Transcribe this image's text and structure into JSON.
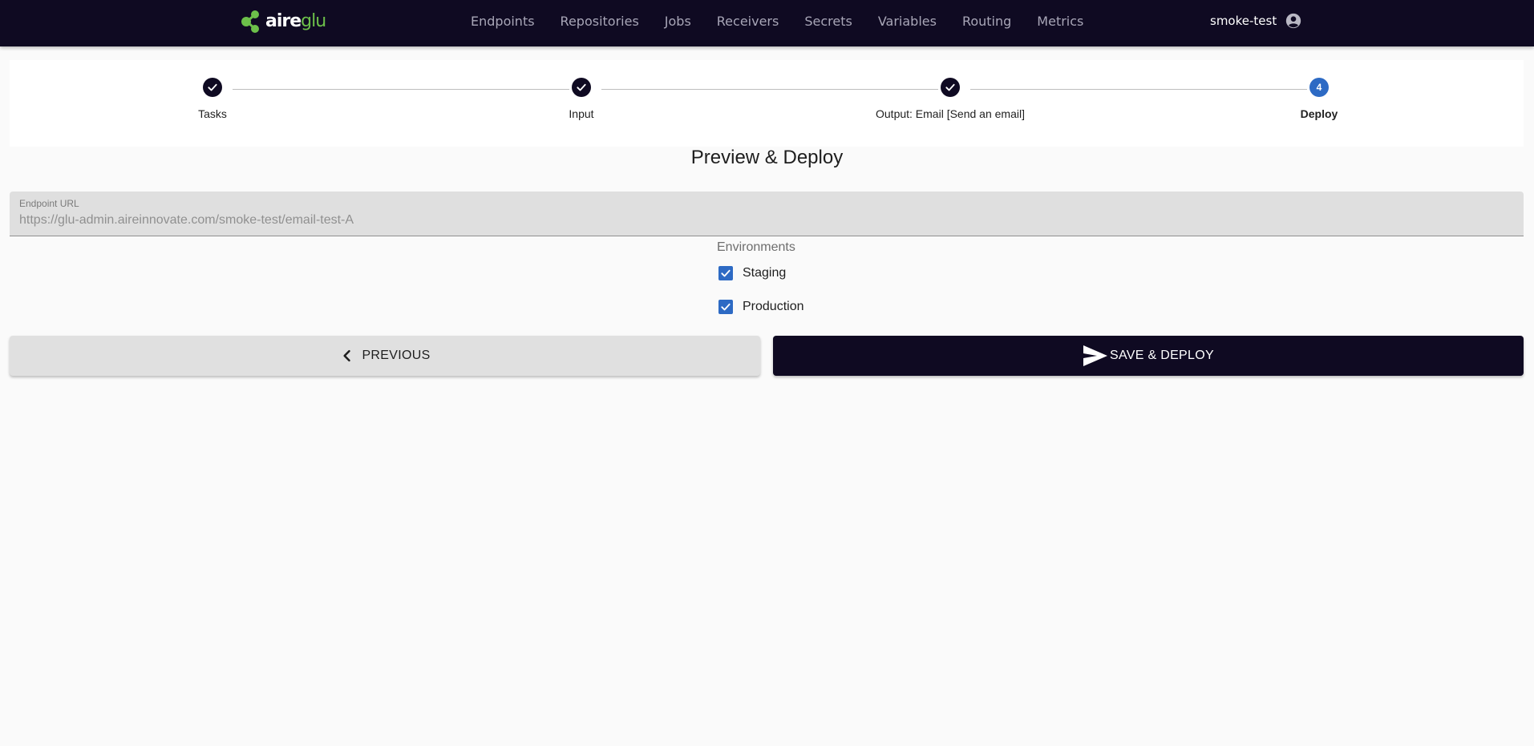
{
  "brand": {
    "part1": "aire",
    "part2": "glu",
    "accent_color": "#6cc04a"
  },
  "nav": {
    "items": [
      "Endpoints",
      "Repositories",
      "Jobs",
      "Receivers",
      "Secrets",
      "Variables",
      "Routing",
      "Metrics"
    ]
  },
  "user": {
    "name": "smoke-test",
    "icon": "account-circle-icon"
  },
  "stepper": {
    "steps": [
      {
        "label": "Tasks",
        "state": "completed"
      },
      {
        "label": "Input",
        "state": "completed"
      },
      {
        "label": "Output: Email [Send an email]",
        "state": "completed"
      },
      {
        "label": "Deploy",
        "state": "active",
        "number": "4"
      }
    ]
  },
  "page": {
    "title": "Preview & Deploy"
  },
  "endpoint": {
    "label": "Endpoint URL",
    "value": "https://glu-admin.aireinnovate.com/smoke-test/email-test-A"
  },
  "environments": {
    "title": "Environments",
    "options": [
      {
        "label": "Staging",
        "checked": true
      },
      {
        "label": "Production",
        "checked": true
      }
    ]
  },
  "actions": {
    "previous_label": "PREVIOUS",
    "deploy_label": "SAVE & DEPLOY"
  },
  "colors": {
    "header_bg": "#0f0a22",
    "primary_blue": "#2d6ac4",
    "page_bg": "#fafafa"
  }
}
